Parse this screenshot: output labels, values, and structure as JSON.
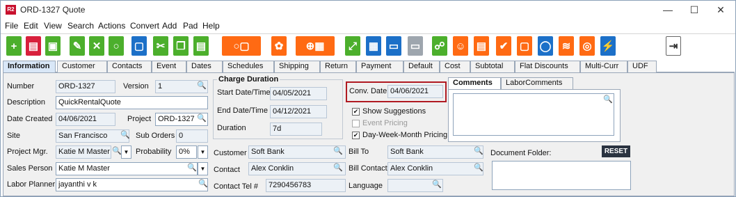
{
  "window": {
    "icon_text": "R2",
    "title": "ORD-1327 Quote",
    "minimize": "—",
    "maximize": "☐",
    "close": "✕"
  },
  "menu": [
    "File",
    "Edit",
    "View",
    "Search",
    "Actions",
    "Convert",
    "Add",
    "Pad",
    "Help"
  ],
  "tabs": [
    "Information",
    "Customer",
    "Contacts",
    "Event",
    "Dates",
    "Schedules",
    "Shipping",
    "Return",
    "Payment",
    "Default",
    "Cost",
    "Subtotal",
    "Flat Discounts",
    "Multi-Curr",
    "UDF"
  ],
  "form": {
    "number_label": "Number",
    "number": "ORD-1327",
    "version_label": "Version",
    "version": "1",
    "description_label": "Description",
    "description": "QuickRentalQuote",
    "date_created_label": "Date Created",
    "date_created": "04/06/2021",
    "project_label": "Project",
    "project": "ORD-1327",
    "site_label": "Site",
    "site": "San Francisco",
    "sub_orders_label": "Sub Orders",
    "sub_orders": "0",
    "project_mgr_label": "Project Mgr.",
    "project_mgr": "Katie M Master",
    "probability_label": "Probability",
    "probability": "0%",
    "sales_person_label": "Sales Person",
    "sales_person": "Katie M Master",
    "labor_planner_label": "Labor Planner",
    "labor_planner": "jayanthi v k"
  },
  "charge_duration": {
    "title": "Charge Duration",
    "start_label": "Start Date/Time",
    "start": "04/05/2021",
    "end_label": "End Date/Time",
    "end": "04/12/2021",
    "duration_label": "Duration",
    "duration": "7d"
  },
  "conv_date": {
    "label": "Conv. Date",
    "value": "04/06/2021"
  },
  "options": {
    "show_suggestions": "Show Suggestions",
    "show_suggestions_checked": "✔",
    "event_pricing": "Event Pricing",
    "dwm_pricing": "Day-Week-Month Pricing",
    "dwm_checked": "✔"
  },
  "comments": {
    "tab1": "Comments",
    "tab2": "LaborComments"
  },
  "customer": {
    "customer_label": "Customer",
    "customer": "Soft Bank",
    "contact_label": "Contact",
    "contact": "Alex Conklin",
    "contact_tel_label": "Contact Tel #",
    "contact_tel": "7290456783"
  },
  "billing": {
    "bill_to_label": "Bill To",
    "bill_to": "Soft Bank",
    "bill_contact_label": "Bill Contact",
    "bill_contact": "Alex Conklin",
    "language_label": "Language",
    "language": ""
  },
  "document_folder": {
    "label": "Document Folder:",
    "reset": "RESET"
  },
  "icons": {
    "search": "🔍",
    "dropdown": "▼"
  }
}
